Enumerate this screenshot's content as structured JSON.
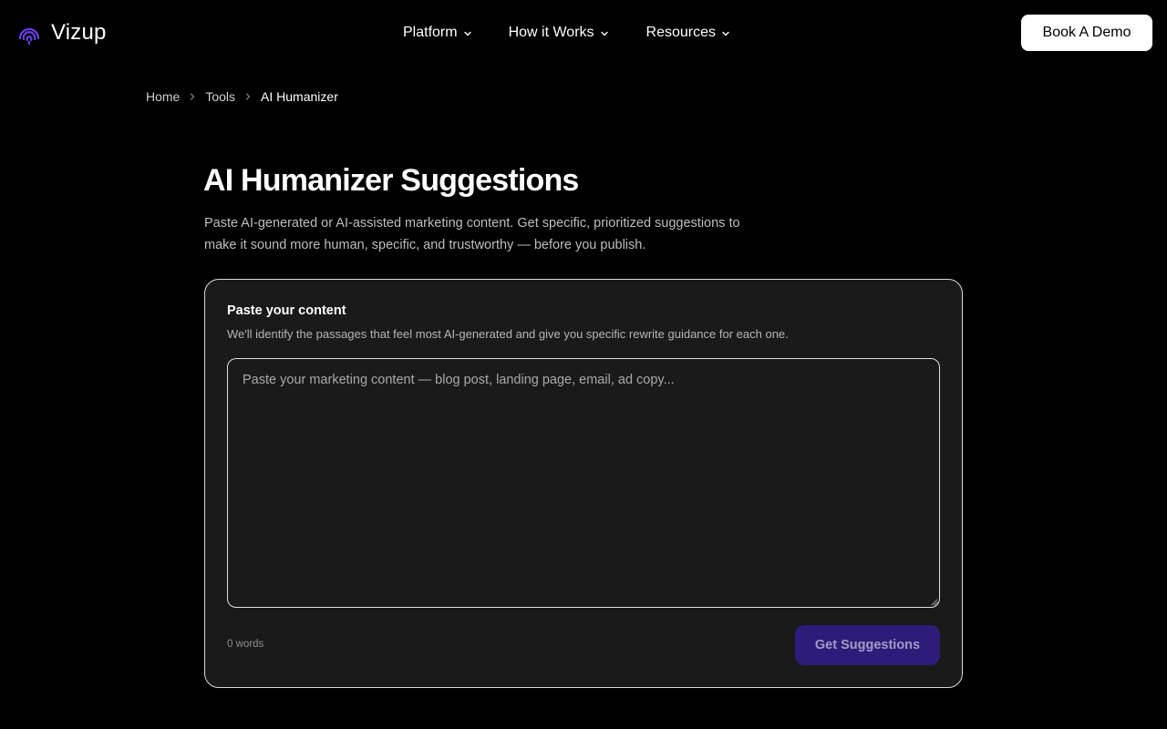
{
  "header": {
    "brand": "Vizup",
    "brand_color": "#6b3de8",
    "logo_icon": "fingerprint-swirl-icon",
    "nav": [
      {
        "label": "Platform",
        "icon": "chevron-down-icon"
      },
      {
        "label": "How it Works",
        "icon": "chevron-down-icon"
      },
      {
        "label": "Resources",
        "icon": "chevron-down-icon"
      }
    ],
    "cta_label": "Book A Demo"
  },
  "breadcrumb": {
    "items": [
      "Home",
      "Tools",
      "AI Humanizer"
    ],
    "separator_icon": "chevron-right-icon"
  },
  "page": {
    "title": "AI Humanizer Suggestions",
    "description": "Paste AI-generated or AI-assisted marketing content. Get specific, prioritized suggestions to make it sound more human, specific, and trustworthy — before you publish."
  },
  "form": {
    "title": "Paste your content",
    "subtitle": "We'll identify the passages that feel most AI-generated and give you specific rewrite guidance for each one.",
    "placeholder": "Paste your marketing content — blog post, landing page, email, ad copy...",
    "value": "",
    "word_count": "0 words",
    "submit_label": "Get Suggestions",
    "submit_disabled": true,
    "submit_color": "#2e1b7a"
  }
}
